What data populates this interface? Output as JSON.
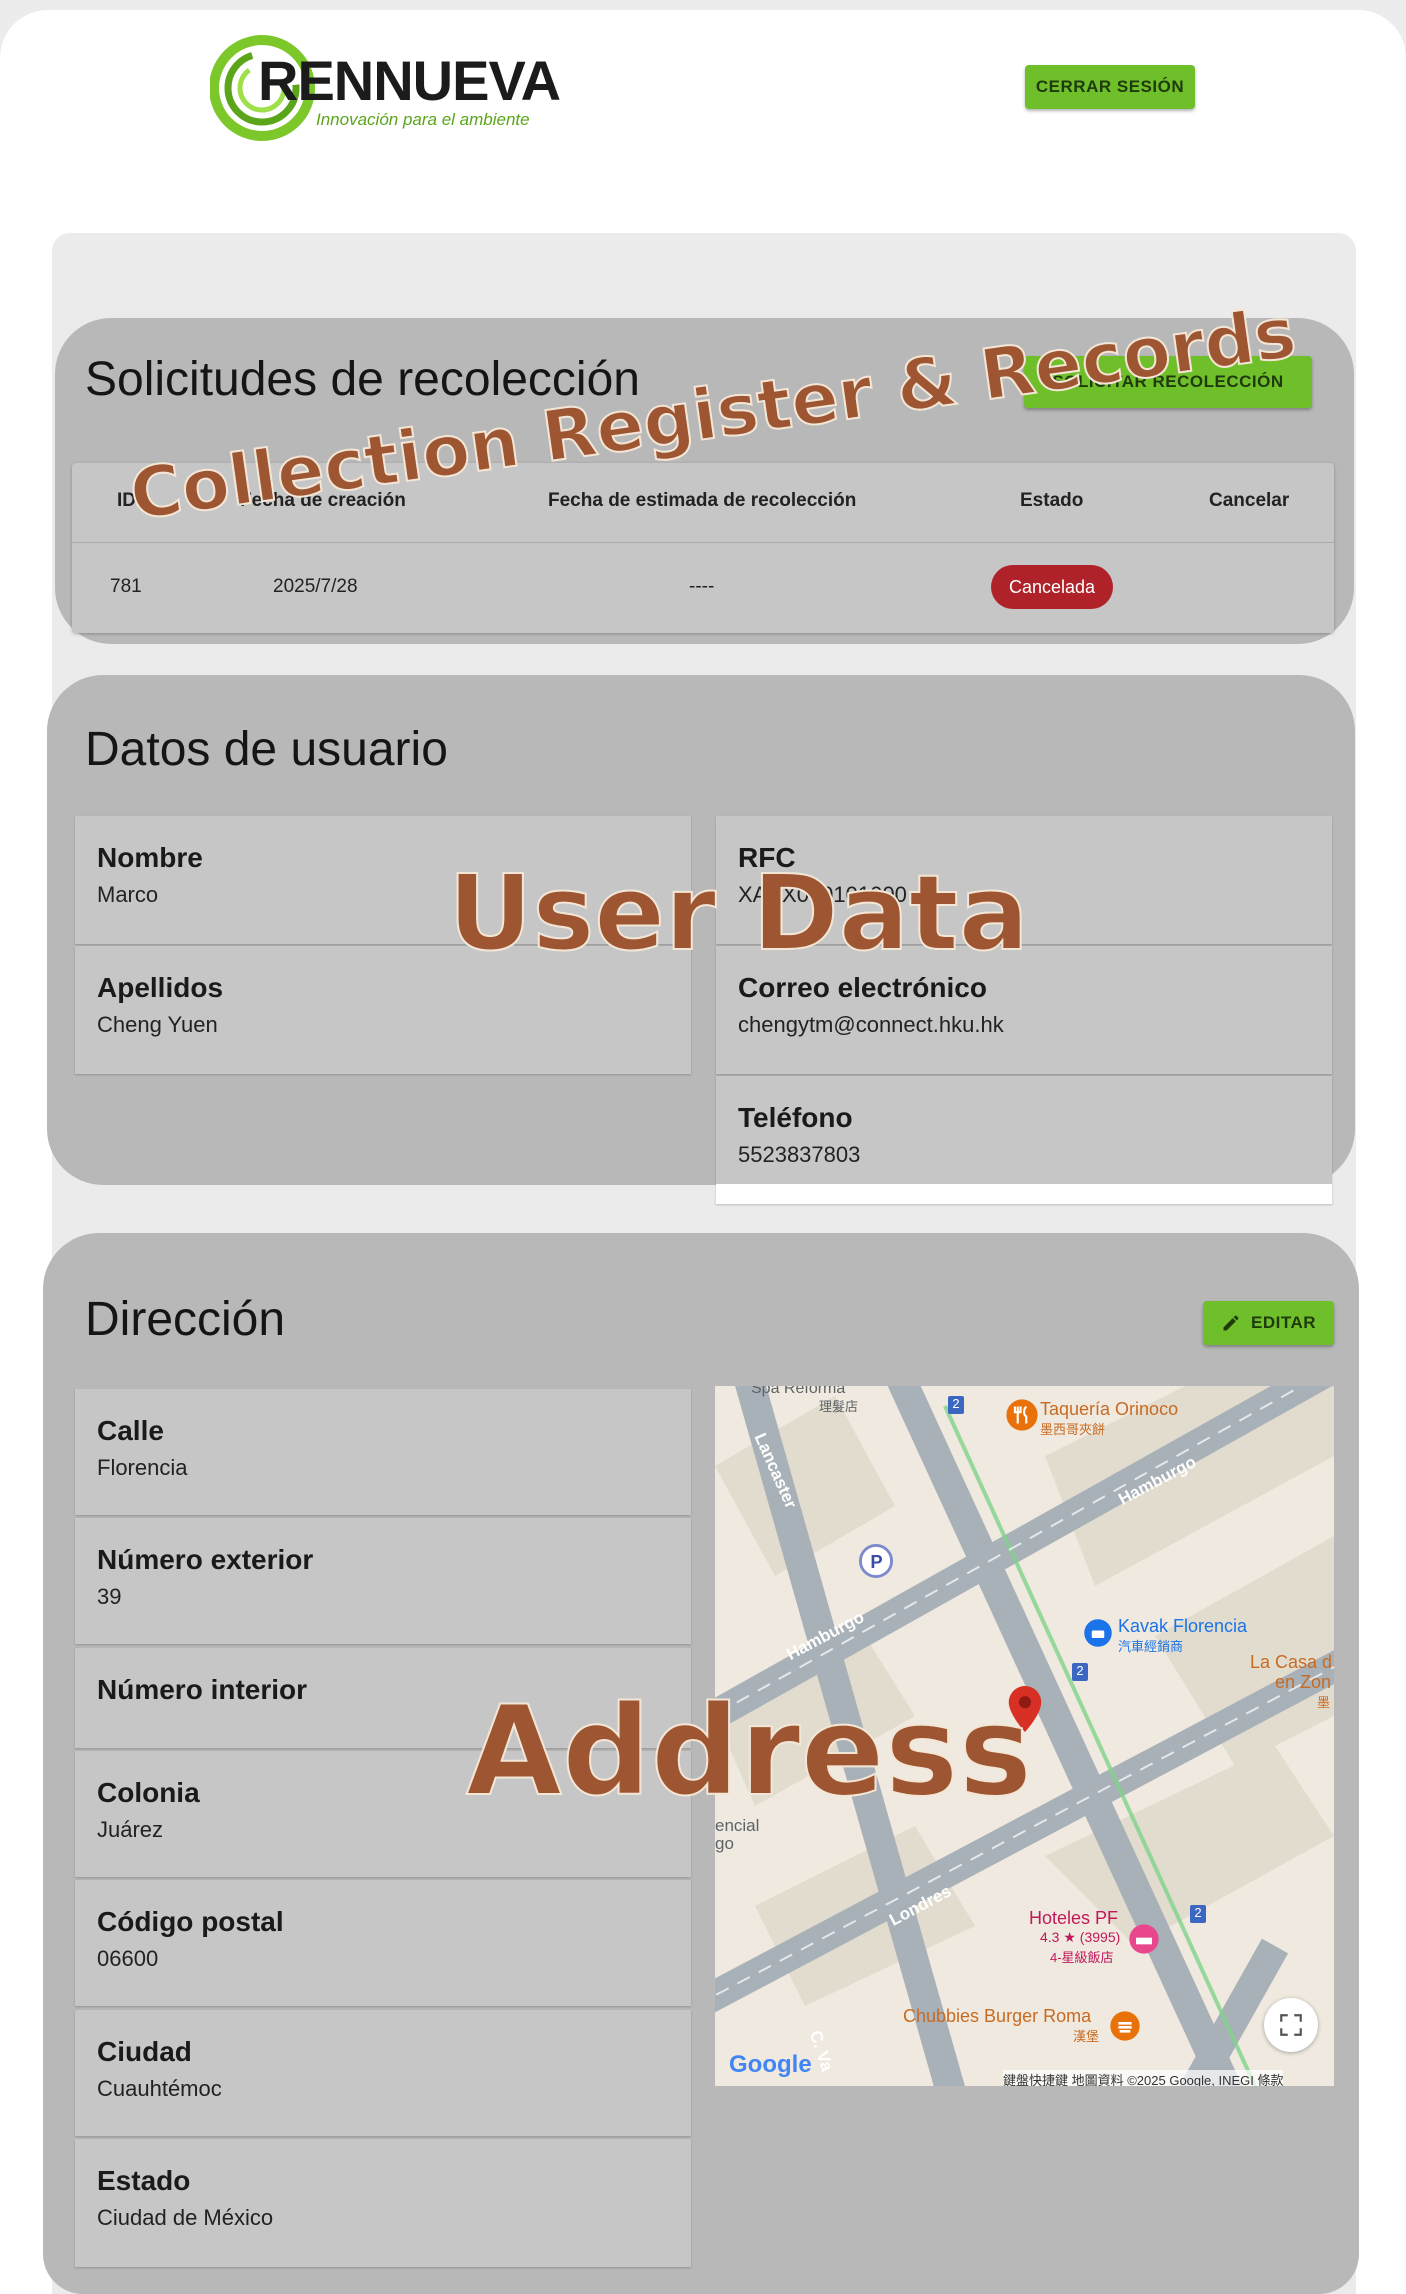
{
  "header": {
    "logo_name": "RENNUEVA",
    "logo_tagline": "Innovación para el ambiente",
    "logout_label": "CERRAR SESIÓN"
  },
  "collection": {
    "title": "Solicitudes de recolección",
    "request_button_label": "SOLICITAR RECOLECCIÓN",
    "columns": [
      "ID",
      "Fecha de creación",
      "Fecha de estimada de recolección",
      "Estado",
      "Cancelar"
    ],
    "rows": [
      {
        "id": "781",
        "created": "2025/7/28",
        "estimated": "----",
        "status": "Cancelada"
      }
    ]
  },
  "user": {
    "title": "Datos de usuario",
    "nombre_label": "Nombre",
    "nombre_value": "Marco",
    "apellidos_label": "Apellidos",
    "apellidos_value": "Cheng Yuen",
    "rfc_label": "RFC",
    "rfc_value": "XAXX010101000",
    "correo_label": "Correo electrónico",
    "correo_value": "chengytm@connect.hku.hk",
    "telefono_label": "Teléfono",
    "telefono_value": "5523837803"
  },
  "address": {
    "title": "Dirección",
    "edit_label": "EDITAR",
    "calle_label": "Calle",
    "calle_value": "Florencia",
    "num_ext_label": "Número exterior",
    "num_ext_value": "39",
    "num_int_label": "Número interior",
    "num_int_value": "",
    "colonia_label": "Colonia",
    "colonia_value": "Juárez",
    "cp_label": "Código postal",
    "cp_value": "06600",
    "ciudad_label": "Ciudad",
    "ciudad_value": "Cuauhtémoc",
    "estado_label": "Estado",
    "estado_value": "Ciudad de México"
  },
  "map": {
    "labels": {
      "spa": "Spa Reforma",
      "spa_cn": "理髮店",
      "taqueria": "Taquería Orinoco",
      "taqueria_cn": "墨西哥夾餅",
      "hamburgo_top": "Hamburgo",
      "lancaster": "Lancaster",
      "hamburgo_mid": "Hamburgo",
      "kavak": "Kavak Florencia",
      "kavak_cn": "汽車經銷商",
      "la_casa_1": "La Casa d",
      "la_casa_2": "en Zon",
      "la_casa_cn": "墨",
      "encial": "encial",
      "go": "go",
      "londres": "Londres",
      "hoteles": "Hoteles PF",
      "hoteles_rating": "4.3 ★ (3995)",
      "hoteles_cn": "4-星級飯店",
      "chubbies": "Chubbies Burger Roma",
      "chubbies_cn": "漢堡",
      "cva": "C. Va",
      "google": "Google",
      "attribution": "鍵盤快捷鍵    地圖資料 ©2025 Google, INEGI    條款",
      "route_2a": "2",
      "route_2b": "2",
      "route_2c": "2"
    }
  },
  "overlays": {
    "collection": "Collection Register & Records",
    "user": "User Data",
    "address": "Address"
  },
  "colors": {
    "accent_green": "#6fbf2a",
    "card_gray": "#b8b8b8",
    "badge_red": "#b0222a",
    "overlay_brown": "#9e5632"
  }
}
